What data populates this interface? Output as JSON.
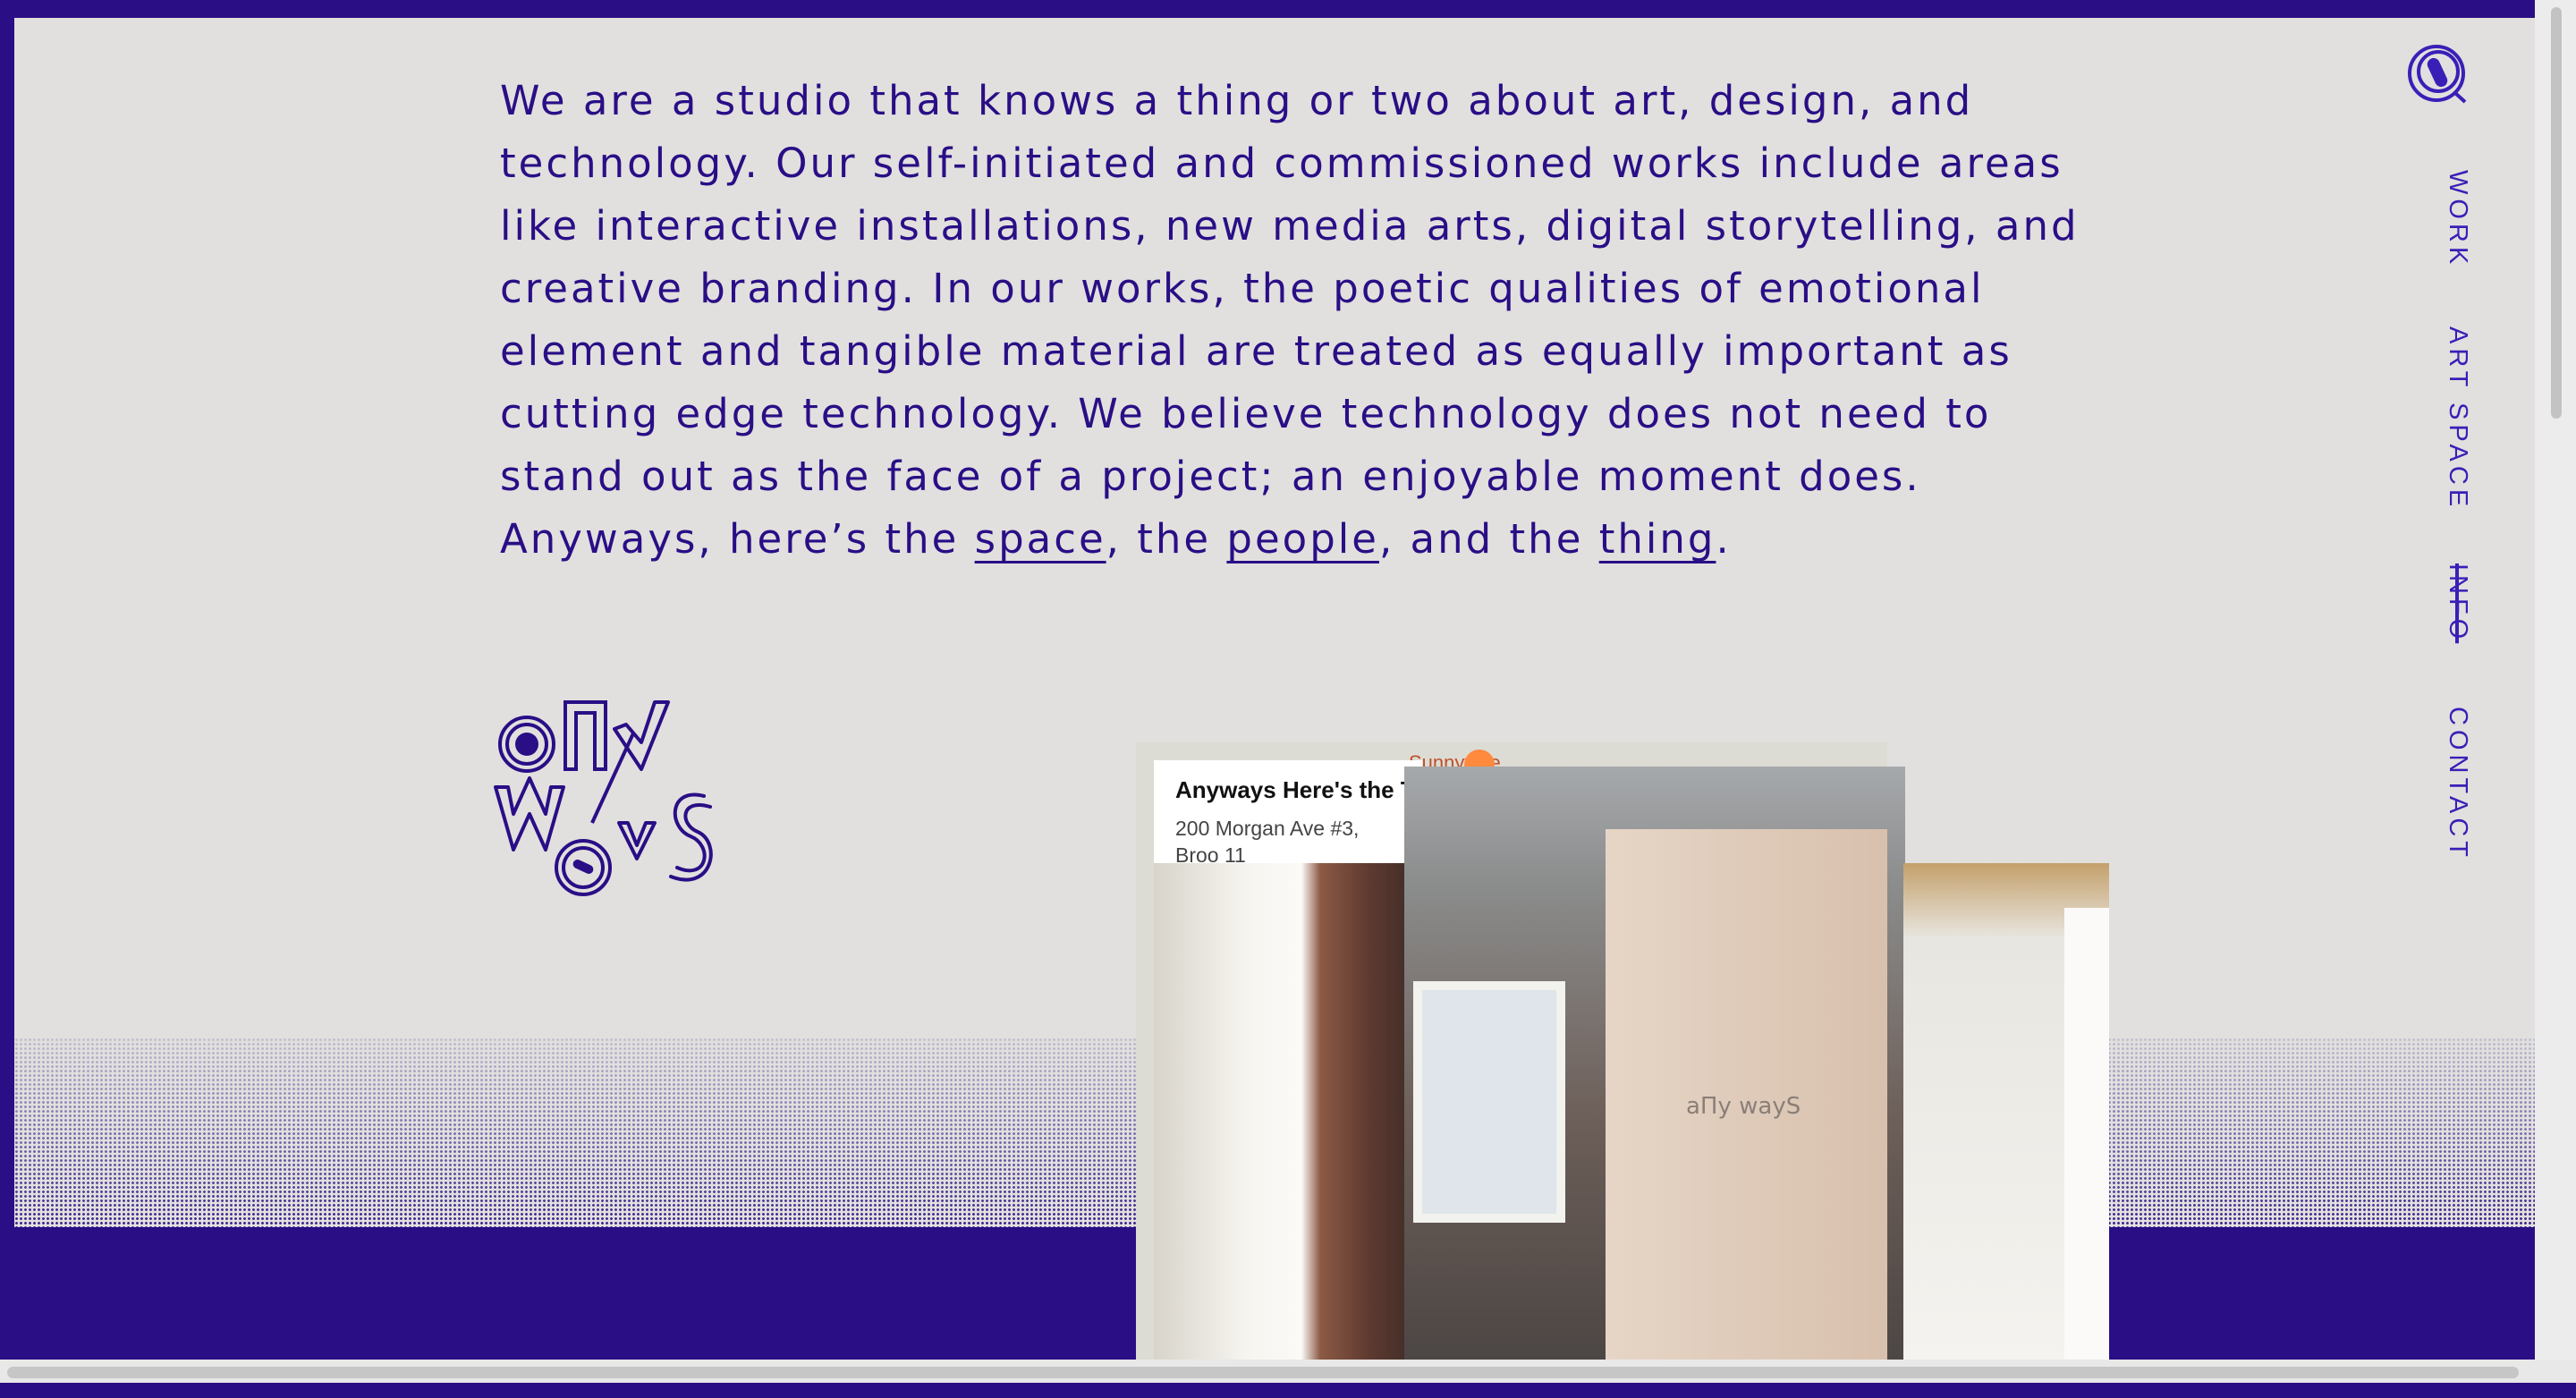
{
  "intro": {
    "text_before": "We are a studio that knows a thing or two about art, design, and technology. Our self-initiated and commissioned works include areas like interactive installations, new media arts, digital storytelling, and creative branding. In our works, the poetic qualities of emotional element and tangible material are treated as equally important as cutting edge technology. We believe technology does not need to stand out as the face of a project; an enjoyable moment does. Anyways, here’s the ",
    "link_space": "space",
    "sep1": ", the ",
    "link_people": "people",
    "sep2": ", and the ",
    "link_thing": "thing",
    "end": "."
  },
  "nav": {
    "work": "WORK",
    "art_space": "ART SPACE",
    "info": "INFO",
    "contact": "CONTACT"
  },
  "map": {
    "title": "Anyways Here's the T",
    "address": "200 Morgan Ave #3, Broo 11",
    "road_label": "Sunnyvale"
  },
  "photo_wall_logo": "aΠy wayS",
  "colors": {
    "brand": "#2a0e86",
    "nav_text": "#3a1fb7",
    "background": "#e1e0de"
  },
  "icons": [
    "anyways-wordmark-logo",
    "circle-logo-icon",
    "map-pin-icon"
  ]
}
